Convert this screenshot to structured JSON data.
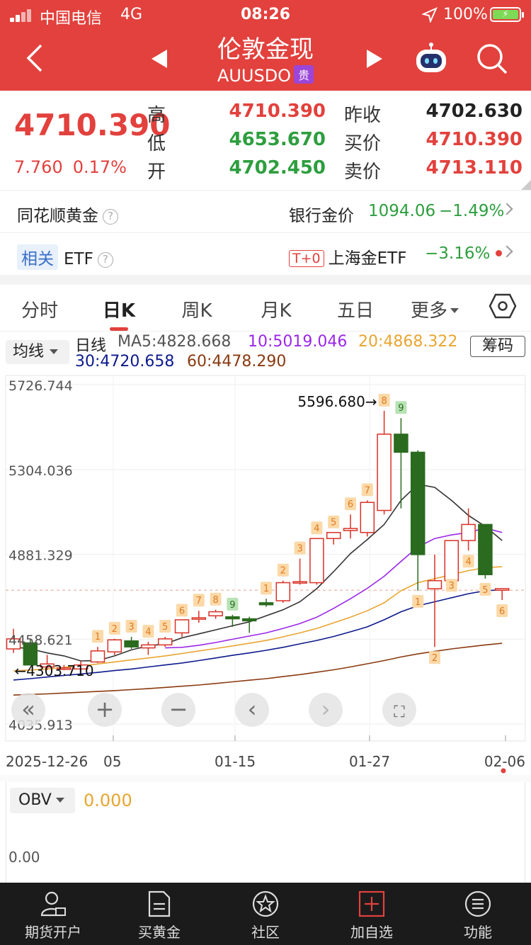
{
  "status": {
    "carrier": "中国电信",
    "network": "4G",
    "time": "08:26",
    "battery": "100%"
  },
  "header": {
    "title": "伦敦金现",
    "symbol": "AUUSDO",
    "tag": "贵"
  },
  "quote": {
    "price": "4710.390",
    "change": "7.760",
    "change_pct": "0.17%",
    "high_label": "高",
    "high": "4710.390",
    "low_label": "低",
    "low": "4653.670",
    "open_label": "开",
    "open": "4702.450",
    "prev_label": "昨收",
    "prev": "4702.630",
    "bid_label": "买价",
    "bid": "4710.390",
    "ask_label": "卖价",
    "ask": "4713.110"
  },
  "row1": {
    "label": "同花顺黄金",
    "item": "银行金价",
    "value": "1094.06",
    "pct": "−1.49%"
  },
  "row2": {
    "badge": "相关",
    "label": "ETF",
    "tag": "T+0",
    "item": "上海金ETF",
    "pct": "−3.16%"
  },
  "tabs": [
    "分时",
    "日K",
    "周K",
    "月K",
    "五日",
    "更多"
  ],
  "ma": {
    "button": "均线",
    "period": "日线",
    "ma5": "MA5:4828.668",
    "ma10": "10:5019.046",
    "ma20": "20:4868.322",
    "ma30": "30:4720.658",
    "ma60": "60:4478.290",
    "chip": "筹码",
    "colors": {
      "ma5": "#333333",
      "ma10": "#9b27e8",
      "ma20": "#e8a530",
      "ma30": "#0d1a8c",
      "ma60": "#8b3a10",
      "up": "#d93025",
      "down": "#2b6b1f"
    }
  },
  "chart_data": {
    "type": "candlestick",
    "y_ticks": [
      "5726.744",
      "5304.036",
      "4881.329",
      "4458.621",
      "4035.913"
    ],
    "x_ticks": [
      "2025-12-26",
      "05",
      "01-15",
      "01-27",
      "02-06"
    ],
    "max_label": "5596.680",
    "min_label": "4303.710",
    "ylim": [
      4035.913,
      5726.744
    ],
    "candles": [
      {
        "o": 4410,
        "h": 4510,
        "l": 4390,
        "c": 4460
      },
      {
        "o": 4440,
        "h": 4460,
        "l": 4340,
        "c": 4330
      },
      {
        "o": 4320,
        "h": 4380,
        "l": 4305,
        "c": 4335
      },
      {
        "o": 4310,
        "h": 4330,
        "l": 4303.71,
        "c": 4315
      },
      {
        "o": 4310,
        "h": 4350,
        "l": 4300,
        "c": 4330
      },
      {
        "o": 4345,
        "h": 4420,
        "l": 4340,
        "c": 4400
      },
      {
        "o": 4395,
        "h": 4460,
        "l": 4380,
        "c": 4455
      },
      {
        "o": 4450,
        "h": 4470,
        "l": 4410,
        "c": 4420
      },
      {
        "o": 4415,
        "h": 4445,
        "l": 4380,
        "c": 4430
      },
      {
        "o": 4430,
        "h": 4470,
        "l": 4420,
        "c": 4460
      },
      {
        "o": 4490,
        "h": 4550,
        "l": 4470,
        "c": 4555
      },
      {
        "o": 4560,
        "h": 4600,
        "l": 4540,
        "c": 4565
      },
      {
        "o": 4575,
        "h": 4605,
        "l": 4560,
        "c": 4595
      },
      {
        "o": 4570,
        "h": 4580,
        "l": 4520,
        "c": 4560
      },
      {
        "o": 4560,
        "h": 4570,
        "l": 4490,
        "c": 4550
      },
      {
        "o": 4640,
        "h": 4660,
        "l": 4620,
        "c": 4630
      },
      {
        "o": 4650,
        "h": 4750,
        "l": 4640,
        "c": 4740
      },
      {
        "o": 4740,
        "h": 4860,
        "l": 4730,
        "c": 4745
      },
      {
        "o": 4740,
        "h": 4960,
        "l": 4730,
        "c": 4960
      },
      {
        "o": 4960,
        "h": 4990,
        "l": 4930,
        "c": 4990
      },
      {
        "o": 5000,
        "h": 5080,
        "l": 4960,
        "c": 5010
      },
      {
        "o": 4990,
        "h": 5150,
        "l": 4970,
        "c": 5140
      },
      {
        "o": 5100,
        "h": 5596.68,
        "l": 5080,
        "c": 5480
      },
      {
        "o": 5480,
        "h": 5560,
        "l": 5110,
        "c": 5390
      },
      {
        "o": 5390,
        "h": 5400,
        "l": 4700,
        "c": 4880
      },
      {
        "o": 4710,
        "h": 4880,
        "l": 4420,
        "c": 4750
      },
      {
        "o": 4750,
        "h": 4950,
        "l": 4780,
        "c": 4950
      },
      {
        "o": 4950,
        "h": 5110,
        "l": 4900,
        "c": 5030
      },
      {
        "o": 5030,
        "h": 5030,
        "l": 4760,
        "c": 4780
      },
      {
        "o": 4702.45,
        "h": 4710.39,
        "l": 4653.67,
        "c": 4710.39
      }
    ],
    "counts": [
      {
        "i": 5,
        "n": "1",
        "pos": "above",
        "green": false
      },
      {
        "i": 6,
        "n": "2",
        "pos": "above",
        "green": false
      },
      {
        "i": 7,
        "n": "3",
        "pos": "above",
        "green": false
      },
      {
        "i": 8,
        "n": "4",
        "pos": "above",
        "green": false
      },
      {
        "i": 9,
        "n": "5",
        "pos": "above",
        "green": false
      },
      {
        "i": 10,
        "n": "6",
        "pos": "above",
        "green": false
      },
      {
        "i": 11,
        "n": "7",
        "pos": "above",
        "green": false
      },
      {
        "i": 12,
        "n": "8",
        "pos": "above",
        "green": false
      },
      {
        "i": 13,
        "n": "9",
        "pos": "above",
        "green": true
      },
      {
        "i": 15,
        "n": "1",
        "pos": "above",
        "green": false
      },
      {
        "i": 16,
        "n": "2",
        "pos": "above",
        "green": false
      },
      {
        "i": 17,
        "n": "3",
        "pos": "above",
        "green": false
      },
      {
        "i": 18,
        "n": "4",
        "pos": "above",
        "green": false
      },
      {
        "i": 19,
        "n": "5",
        "pos": "above",
        "green": false
      },
      {
        "i": 20,
        "n": "6",
        "pos": "above",
        "green": false
      },
      {
        "i": 21,
        "n": "7",
        "pos": "above",
        "green": false
      },
      {
        "i": 22,
        "n": "8",
        "pos": "above",
        "green": false
      },
      {
        "i": 23,
        "n": "9",
        "pos": "above",
        "green": true
      },
      {
        "i": 24,
        "n": "1",
        "pos": "below",
        "green": false
      },
      {
        "i": 25,
        "n": "2",
        "pos": "below",
        "green": false
      },
      {
        "i": 26,
        "n": "3",
        "pos": "below",
        "green": false
      },
      {
        "i": 27,
        "n": "4",
        "pos": "below",
        "green": false
      },
      {
        "i": 28,
        "n": "5",
        "pos": "below",
        "green": false
      },
      {
        "i": 29,
        "n": "6",
        "pos": "below",
        "green": false
      }
    ],
    "ma_series": {
      "ma5": [
        4420,
        4410,
        4390,
        4375,
        4350,
        4352,
        4375,
        4405,
        4425,
        4435,
        4465,
        4485,
        4505,
        4525,
        4545,
        4575,
        4605,
        4645,
        4710,
        4795,
        4885,
        4955,
        5030,
        5150,
        5230,
        5215,
        5150,
        5075,
        5020,
        4950
      ],
      "ma10": [
        null,
        null,
        null,
        null,
        null,
        null,
        null,
        null,
        null,
        4415,
        4418,
        4428,
        4442,
        4458,
        4474,
        4490,
        4512,
        4536,
        4568,
        4612,
        4660,
        4712,
        4772,
        4846,
        4918,
        4960,
        4978,
        4990,
        5012,
        4990
      ],
      "ma20": [
        4300,
        4305,
        4310,
        4318,
        4325,
        4335,
        4345,
        4355,
        4365,
        4375,
        4387,
        4400,
        4412,
        4425,
        4438,
        4452,
        4470,
        4490,
        4512,
        4540,
        4568,
        4600,
        4640,
        4700,
        4740,
        4760,
        4780,
        4800,
        4815,
        4820
      ],
      "ma30": [
        4255,
        4262,
        4270,
        4278,
        4285,
        4293,
        4302,
        4310,
        4320,
        4330,
        4340,
        4352,
        4365,
        4378,
        4390,
        4403,
        4418,
        4435,
        4452,
        4472,
        4495,
        4520,
        4555,
        4595,
        4625,
        4645,
        4665,
        4685,
        4700,
        4705
      ],
      "ma60": [
        4180,
        4183,
        4186,
        4190,
        4194,
        4198,
        4202,
        4207,
        4212,
        4218,
        4224,
        4230,
        4238,
        4246,
        4254,
        4262,
        4272,
        4282,
        4294,
        4306,
        4320,
        4336,
        4352,
        4370,
        4385,
        4398,
        4410,
        4420,
        4430,
        4438
      ]
    },
    "ref_price": 4702.63
  },
  "obv": {
    "button": "OBV",
    "value": "0.000",
    "zero": "0.00"
  },
  "bottom": [
    {
      "label": "期货开户",
      "icon": "user-card-icon"
    },
    {
      "label": "买黄金",
      "icon": "document-icon"
    },
    {
      "label": "社区",
      "icon": "star-circle-icon"
    },
    {
      "label": "加自选",
      "icon": "plus-square-icon"
    },
    {
      "label": "功能",
      "icon": "menu-circle-icon"
    }
  ]
}
